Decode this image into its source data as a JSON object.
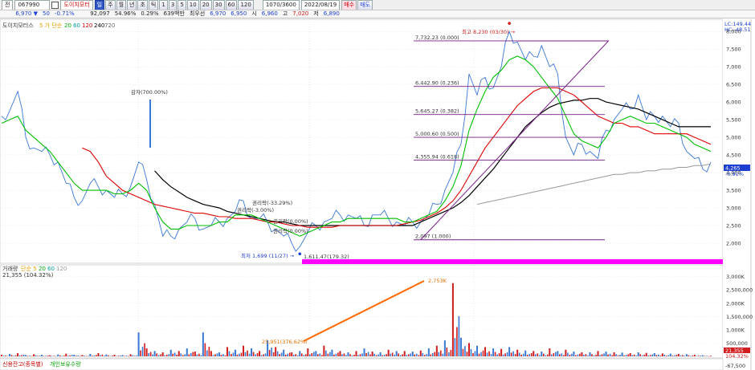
{
  "toolbar": {
    "mode": "전",
    "code": "067990",
    "checkbox": "",
    "stock_name": "도이치모터",
    "buttons": [
      "일",
      "주",
      "월",
      "년",
      "초",
      "틱"
    ],
    "periods": [
      "1",
      "3",
      "5",
      "10",
      "20",
      "30",
      "60",
      "120"
    ],
    "count": "1070/3600",
    "date": "2022/08/19",
    "buy": "매수",
    "sell": "매도"
  },
  "quote": {
    "price": "6,970 ▼",
    "change": "50",
    "change_pct": "-0.71%",
    "volume": "92,097",
    "vol_ratio": "54.96%",
    "turnover": "0.29%",
    "amount_label": "639백만",
    "prev_label": "최우선",
    "prev": "6,970",
    "bid": "6,950",
    "open_label": "시",
    "open": "6,960",
    "high_label": "고",
    "high": "7,020",
    "low_label": "저",
    "low": "6,890"
  },
  "price_panel": {
    "legend_name": "도이치모터스",
    "legend_ma_label": "5 가 단순",
    "legend_ma": [
      "20",
      "60",
      "120",
      "240",
      "720"
    ],
    "top_right_1": "LC:149.44",
    "top_right_2": "HC:-48.51",
    "last_price_tag": "4,265",
    "last_change_tag": "-0.91%",
    "annotations": {
      "high": "최고 8,230 (03/30) →",
      "low": "최저 1,699 (11/27) →",
      "capital_reduction": "감자(700.00%)",
      "rights1": "권리락(-33.29%)",
      "rights2": "권리락(-3.00%)",
      "rights3": "권리락(0.00%)",
      "rights4": "권리락(0.00%)",
      "fib_low": "1,611.47(179.32)"
    },
    "fib_labels": [
      "7,732.23 (0.000)",
      "6,442.90 (0.236)",
      "5,645.27 (0.382)",
      "5,000.60 (0.500)",
      "4,355.94 (0.618)",
      "2,097 (1.000)"
    ]
  },
  "volume_panel": {
    "legend_name": "거래량",
    "legend_ma_label": "단순 5",
    "legend_ma": [
      "20",
      "60",
      "120"
    ],
    "legend_value": "21,355 (104.32%)",
    "peak_label": "2,753K",
    "trend_label": "25,951(376.62%)",
    "last_tag": "21,355",
    "last_pct_tag": "104.32%"
  },
  "footer": {
    "credit": "신용잔고(종목별)",
    "individual": "개인보유수량",
    "last_value": "-67,500"
  },
  "chart_data": [
    {
      "type": "line",
      "name": "price",
      "y_axis": {
        "ylim": [
          1500,
          8300
        ],
        "ticks": [
          2000,
          2500,
          3000,
          3500,
          4000,
          4500,
          5000,
          5500,
          6000,
          6500,
          7000,
          7500,
          8000
        ]
      },
      "grid": true,
      "x": [
        0,
        10,
        20,
        30,
        40,
        50,
        60,
        70,
        80,
        90,
        100,
        110,
        120,
        130,
        140,
        150,
        160,
        170,
        180,
        190,
        200,
        210,
        220,
        230,
        240,
        250,
        260,
        270,
        280,
        290,
        300,
        310,
        320,
        330,
        340,
        350,
        360,
        370,
        380,
        390,
        400,
        410,
        420,
        430,
        440,
        450,
        460,
        470,
        480,
        490,
        500,
        510,
        520,
        530,
        540,
        550,
        560,
        570,
        580,
        590,
        600,
        610,
        620,
        630,
        640,
        650,
        660,
        670,
        680,
        690,
        700,
        710,
        720,
        730,
        740,
        750,
        760,
        770,
        780,
        790,
        800,
        810,
        820,
        830,
        840,
        850,
        860,
        870,
        880
      ],
      "close": [
        5600,
        5750,
        6300,
        5000,
        4700,
        4600,
        4500,
        4300,
        3700,
        3300,
        3200,
        3700,
        3600,
        3500,
        3300,
        3400,
        3600,
        4300,
        3800,
        3100,
        2200,
        2200,
        2400,
        2600,
        2700,
        2400,
        2500,
        2600,
        2700,
        2900,
        3200,
        2700,
        2700,
        2600,
        2400,
        2200,
        2000,
        1900,
        2300,
        2500,
        2600,
        2700,
        2800,
        2800,
        2700,
        2500,
        2800,
        2800,
        2700,
        2600,
        2500,
        2600,
        2600,
        2800,
        3100,
        3500,
        4000,
        4800,
        6800,
        6200,
        6700,
        6400,
        7000,
        8000,
        7700,
        7200,
        7300,
        7600,
        7000,
        6800,
        5000,
        4500,
        4800,
        4600,
        4400,
        5200,
        5500,
        5800,
        5800,
        6200,
        5500,
        5600,
        5600,
        5300,
        5400,
        4600,
        4400,
        4100,
        4300
      ],
      "ma20": [
        5400,
        5500,
        5600,
        5200,
        5000,
        4800,
        4600,
        4300,
        4000,
        3700,
        3500,
        3500,
        3500,
        3500,
        3400,
        3400,
        3500,
        3700,
        3500,
        3000,
        2600,
        2400,
        2400,
        2500,
        2500,
        2500,
        2500,
        2600,
        2600,
        2800,
        2800,
        2800,
        2700,
        2600,
        2500,
        2400,
        2300,
        2200,
        2300,
        2400,
        2500,
        2600,
        2600,
        2700,
        2700,
        2700,
        2700,
        2700,
        2700,
        2700,
        2600,
        2600,
        2700,
        2800,
        2900,
        3200,
        3600,
        4200,
        5200,
        5800,
        6300,
        6700,
        6900,
        7200,
        7300,
        7200,
        7000,
        6700,
        6400,
        6100,
        5600,
        5100,
        4900,
        4800,
        4700,
        5000,
        5400,
        5500,
        5600,
        5500,
        5400,
        5400,
        5300,
        5200,
        5100,
        5000,
        4800,
        4700,
        4600
      ],
      "ma120": [
        null,
        null,
        null,
        null,
        null,
        null,
        null,
        null,
        null,
        null,
        4700,
        4600,
        4300,
        3900,
        3700,
        3500,
        3400,
        3300,
        3200,
        3100,
        3050,
        3000,
        2950,
        2900,
        2850,
        2850,
        2800,
        2750,
        2750,
        2700,
        2700,
        2700,
        2650,
        2600,
        2600,
        2550,
        2500,
        2500,
        2450,
        2450,
        2450,
        2450,
        2500,
        2500,
        2500,
        2500,
        2500,
        2500,
        2500,
        2500,
        2550,
        2600,
        2650,
        2750,
        2850,
        3000,
        3200,
        3500,
        3900,
        4300,
        4700,
        5000,
        5300,
        5600,
        5900,
        6100,
        6300,
        6400,
        6400,
        6400,
        6300,
        6200,
        6000,
        5800,
        5600,
        5500,
        5400,
        5400,
        5300,
        5300,
        5200,
        5100,
        5100,
        5100,
        5100,
        5100,
        5000,
        4900,
        4800
      ],
      "ma240": [
        null,
        null,
        null,
        null,
        null,
        null,
        null,
        null,
        null,
        null,
        null,
        null,
        null,
        null,
        null,
        null,
        null,
        null,
        null,
        4050,
        3800,
        3600,
        3450,
        3300,
        3200,
        3100,
        3050,
        3000,
        2900,
        2850,
        2800,
        2750,
        2700,
        2650,
        2600,
        2600,
        2550,
        2500,
        2500,
        2500,
        2500,
        2500,
        2500,
        2500,
        2500,
        2500,
        2500,
        2500,
        2500,
        2500,
        2500,
        2500,
        2600,
        2700,
        2800,
        2900,
        3000,
        3150,
        3350,
        3600,
        3850,
        4100,
        4400,
        4700,
        5000,
        5300,
        5500,
        5700,
        5850,
        5950,
        6000,
        6050,
        6050,
        6100,
        6100,
        6000,
        5950,
        5900,
        5850,
        5800,
        5700,
        5600,
        5500,
        5400,
        5300,
        5300,
        5300,
        5300,
        5300
      ],
      "ma720": [
        null,
        null,
        null,
        null,
        null,
        null,
        null,
        null,
        null,
        null,
        null,
        null,
        null,
        null,
        null,
        null,
        null,
        null,
        null,
        null,
        null,
        null,
        null,
        null,
        null,
        null,
        null,
        null,
        null,
        null,
        null,
        null,
        null,
        null,
        null,
        null,
        null,
        null,
        null,
        null,
        null,
        null,
        null,
        null,
        null,
        null,
        null,
        null,
        null,
        null,
        null,
        null,
        null,
        null,
        null,
        null,
        null,
        null,
        null,
        3100,
        3150,
        3200,
        3250,
        3300,
        3350,
        3400,
        3450,
        3500,
        3550,
        3600,
        3650,
        3700,
        3750,
        3800,
        3850,
        3900,
        3950,
        3950,
        4000,
        4000,
        4050,
        4050,
        4100,
        4100,
        4150,
        4150,
        4200,
        4200,
        4250
      ],
      "levels": [
        7732.23,
        6442.9,
        5645.27,
        5000.6,
        4355.94,
        2097
      ],
      "high": 8230,
      "low": 1699
    },
    {
      "type": "bar",
      "name": "volume",
      "y_axis": {
        "ylim": [
          0,
          3200000
        ],
        "ticks": [
          500000,
          1000000,
          1500000,
          2000000,
          2500000,
          3000000
        ]
      },
      "values": [
        60000,
        90000,
        120000,
        50000,
        80000,
        60000,
        40000,
        70000,
        100000,
        60000,
        50000,
        90000,
        120000,
        70000,
        60000,
        50000,
        80000,
        900000,
        300000,
        200000,
        150000,
        250000,
        200000,
        300000,
        180000,
        900000,
        200000,
        150000,
        350000,
        250000,
        400000,
        300000,
        200000,
        600000,
        350000,
        250000,
        150000,
        200000,
        300000,
        200000,
        400000,
        250000,
        200000,
        150000,
        200000,
        300000,
        180000,
        150000,
        250000,
        200000,
        200000,
        180000,
        220000,
        300000,
        400000,
        600000,
        2753000,
        700000,
        500000,
        400000,
        350000,
        300000,
        280000,
        350000,
        250000,
        220000,
        200000,
        180000,
        300000,
        200000,
        250000,
        180000,
        150000,
        150000,
        200000,
        180000,
        150000,
        140000,
        120000,
        150000,
        130000,
        120000,
        110000,
        100000,
        90000,
        80000,
        60000,
        40000,
        21355
      ]
    }
  ]
}
